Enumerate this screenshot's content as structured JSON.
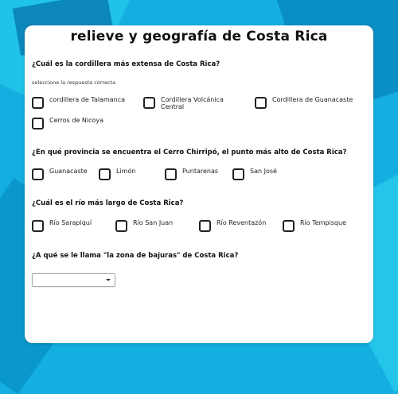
{
  "page": {
    "title": "relieve y geografía de Costa Rica"
  },
  "questions": [
    {
      "text": "¿Cuál es la cordillera más extensa de Costa Rica?",
      "hint": "seleccione la respuesta correcta",
      "options": [
        "cordillera de Talamanca",
        "Cordillera Volcánica\nCentral",
        "Cordillera de Guanacaste",
        "Cerros de Nicoya"
      ]
    },
    {
      "text": "¿En qué provincia se encuentra el Cerro Chirripó, el punto más alto de Costa Rica?",
      "options": [
        "Guanacaste",
        "Limón",
        "Puntarenas",
        "San José"
      ]
    },
    {
      "text": "¿Cuál es el río más largo de Costa Rica?",
      "options": [
        "Río Sarapiquí",
        "Río San Juan",
        "Río Reventazón",
        "Río Tempisque"
      ]
    },
    {
      "text": "¿A qué se le llama \"la zona de bajuras\" de Costa Rica?",
      "select": {
        "value": ""
      }
    }
  ],
  "colors": {
    "background": "#14aee0",
    "card": "#ffffff",
    "checkbox_border": "#222222"
  },
  "icons": {
    "checkbox": "checkbox-icon",
    "dropdown": "chevron-down-icon"
  }
}
